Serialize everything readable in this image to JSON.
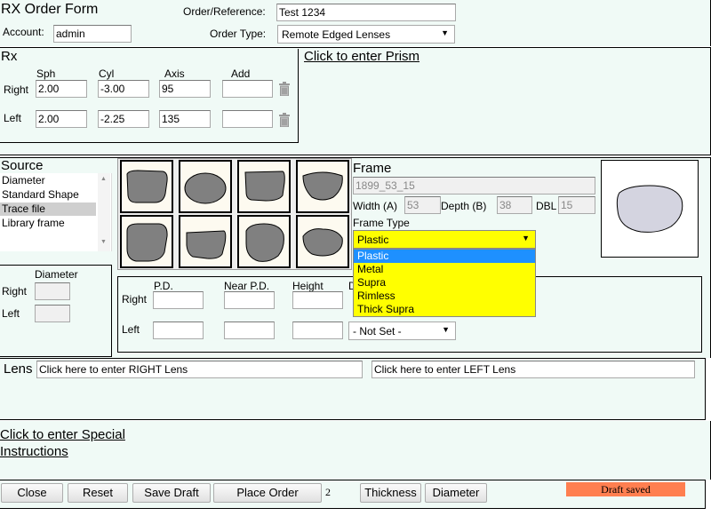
{
  "header": {
    "title": "RX Order Form",
    "account_label": "Account:",
    "account_value": "admin",
    "order_ref_label": "Order/Reference:",
    "order_ref_value": "Test 1234",
    "order_type_label": "Order Type:",
    "order_type_value": "Remote Edged Lenses"
  },
  "rx": {
    "title": "Rx",
    "prism_link": "Click to enter Prism",
    "col_sph": "Sph",
    "col_cyl": "Cyl",
    "col_axis": "Axis",
    "col_add": "Add",
    "right_label": "Right",
    "left_label": "Left",
    "right": {
      "sph": "2.00",
      "cyl": "-3.00",
      "axis": "95",
      "add": ""
    },
    "left": {
      "sph": "2.00",
      "cyl": "-2.25",
      "axis": "135",
      "add": ""
    }
  },
  "source": {
    "title": "Source",
    "items": [
      "Diameter",
      "Standard Shape",
      "Trace file",
      "Library frame"
    ],
    "selected": "Trace file"
  },
  "frame": {
    "title": "Frame",
    "name_value": "1899_53_15",
    "width_label": "Width (A)",
    "width_value": "53",
    "depth_label": "Depth (B)",
    "depth_value": "38",
    "dbl_label": "DBL",
    "dbl_value": "15",
    "type_label": "Frame Type",
    "type_value": "Plastic",
    "type_options": [
      "Plastic",
      "Metal",
      "Supra",
      "Rimless",
      "Thick Supra"
    ]
  },
  "diameter": {
    "title": "Diameter",
    "right_label": "Right",
    "left_label": "Left"
  },
  "measurements": {
    "col_pd": "P.D.",
    "col_near_pd": "Near P.D.",
    "col_height": "Height",
    "col_d": "D",
    "right_label": "Right",
    "left_label": "Left",
    "left_select": "- Not Set -"
  },
  "lens": {
    "title": "Lens",
    "right_placeholder": "Click here to enter RIGHT Lens",
    "left_placeholder": "Click here to enter LEFT Lens"
  },
  "special": {
    "line1": "Click to enter Special",
    "line2": "Instructions"
  },
  "footer": {
    "close": "Close",
    "reset": "Reset",
    "save_draft": "Save Draft",
    "place_order": "Place Order",
    "count": "2",
    "thickness": "Thickness",
    "diameter": "Diameter",
    "status": "Draft saved"
  },
  "colors": {
    "panel_bg": "#f0faf6",
    "dropdown_bg": "#ffff00",
    "dropdown_selected": "#1e90ff",
    "status_bg": "#ff7f50",
    "shape_fill": "#808080",
    "preview_fill": "#d4d4e0"
  }
}
